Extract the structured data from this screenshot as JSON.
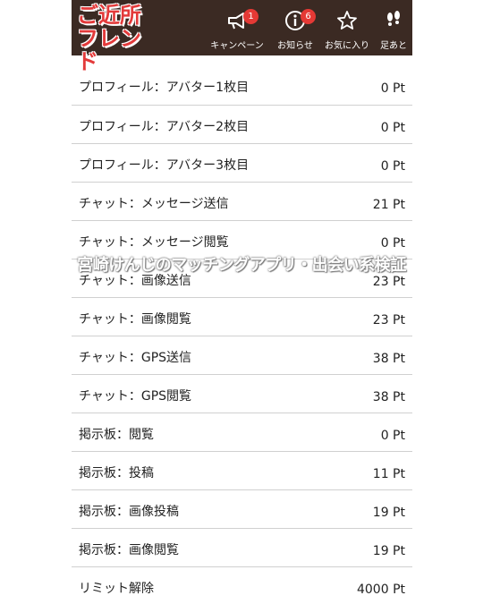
{
  "header": {
    "logo_line1": "ご近所",
    "logo_line2": "フレンド",
    "nav": [
      {
        "label": "キャンペーン",
        "badge": "1",
        "icon": "megaphone-icon"
      },
      {
        "label": "お知らせ",
        "badge": "6",
        "icon": "info-icon"
      },
      {
        "label": "お気に入り",
        "icon": "star-icon"
      },
      {
        "label": "足あと",
        "icon": "footprints-icon"
      }
    ]
  },
  "rows": [
    {
      "label": "プロフィール：アバター1枚目",
      "value": "0 Pt"
    },
    {
      "label": "プロフィール：アバター2枚目",
      "value": "0 Pt"
    },
    {
      "label": "プロフィール：アバター3枚目",
      "value": "0 Pt"
    },
    {
      "label": "チャット：メッセージ送信",
      "value": "21 Pt"
    },
    {
      "label": "チャット：メッセージ閲覧",
      "value": "0 Pt"
    },
    {
      "label": "チャット：画像送信",
      "value": "23 Pt"
    },
    {
      "label": "チャット：画像閲覧",
      "value": "23 Pt"
    },
    {
      "label": "チャット：GPS送信",
      "value": "38 Pt"
    },
    {
      "label": "チャット：GPS閲覧",
      "value": "38 Pt"
    },
    {
      "label": "掲示板：閲覧",
      "value": "0 Pt"
    },
    {
      "label": "掲示板：投稿",
      "value": "11 Pt"
    },
    {
      "label": "掲示板：画像投稿",
      "value": "19 Pt"
    },
    {
      "label": "掲示板：画像閲覧",
      "value": "19 Pt"
    },
    {
      "label": "リミット解除",
      "value": "4000 Pt"
    }
  ],
  "watermark": "宮崎けんじのマッチングアプリ・出会い系検証",
  "colors": {
    "header_bg": "#3b2a23",
    "logo": "#e33a3a",
    "badge": "#e53935"
  }
}
